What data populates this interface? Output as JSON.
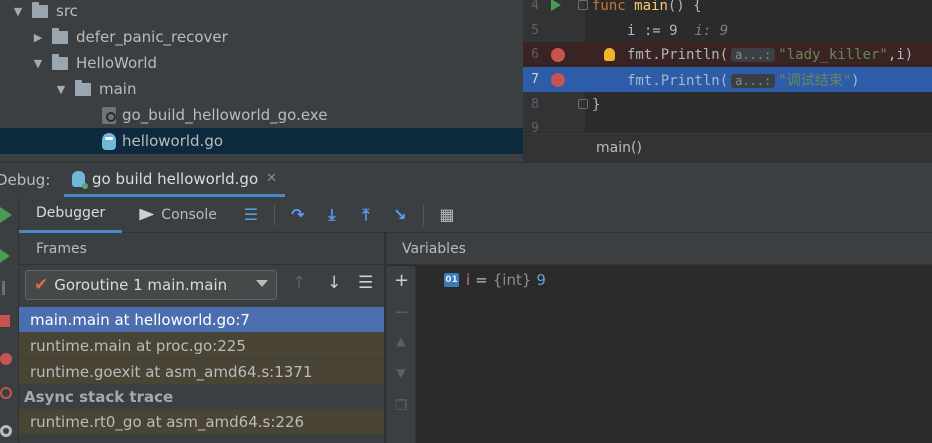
{
  "project_tree": {
    "items": [
      {
        "label": "src",
        "kind": "folder",
        "expanded": true
      },
      {
        "label": "defer_panic_recover",
        "kind": "folder",
        "expanded": false
      },
      {
        "label": "HelloWorld",
        "kind": "folder",
        "expanded": true
      },
      {
        "label": "main",
        "kind": "folder",
        "expanded": true
      },
      {
        "label": "go_build_helloworld_go.exe",
        "kind": "file-exe"
      },
      {
        "label": "helloworld.go",
        "kind": "file-go",
        "selected": true
      }
    ]
  },
  "editor": {
    "lines": [
      {
        "num": "4",
        "code_kw": "func",
        "code_fn": "main",
        "code_rest": "() {"
      },
      {
        "num": "5",
        "code": "i := 9",
        "inlay": "i: 9"
      },
      {
        "num": "6",
        "code_pre": "fmt.Println(",
        "hint": "a...:",
        "str": "\"lady_killer\"",
        "code_post": ",i)",
        "breakpoint": true
      },
      {
        "num": "7",
        "code_pre": "fmt.Println(",
        "hint": "a...:",
        "str": "\"调试结束\"",
        "code_post": ")",
        "breakpoint": true,
        "current": true
      },
      {
        "num": "8",
        "code": "}"
      },
      {
        "num": "9",
        "code": ""
      }
    ],
    "breadcrumb": "main()"
  },
  "debug_bar": {
    "label": "Debug:",
    "session_tab": "go build helloworld.go",
    "close": "✕"
  },
  "debugger_toolbar": {
    "tabs": [
      {
        "label": "Debugger",
        "active": true
      },
      {
        "label": "Console",
        "active": false
      }
    ],
    "icons": [
      "menu-icon",
      "step-over-icon",
      "step-into-icon",
      "step-out-icon",
      "run-to-cursor-icon",
      "evaluate-icon"
    ]
  },
  "frames": {
    "header": "Frames",
    "goroutine": "Goroutine 1 main.main",
    "items": [
      {
        "label": "main.main at helloworld.go:7",
        "selected": true
      },
      {
        "label": "runtime.main at proc.go:225",
        "library": true
      },
      {
        "label": "runtime.goexit at asm_amd64.s:1371",
        "library": true
      }
    ],
    "async_header": "Async stack trace",
    "async_items": [
      {
        "label": "runtime.rt0_go at asm_amd64.s:226",
        "library": true
      }
    ]
  },
  "variables": {
    "header": "Variables",
    "items": [
      {
        "icon": "01",
        "name": "i",
        "eq": "=",
        "type": "{int}",
        "value": "9"
      }
    ]
  },
  "colors": {
    "selection": "#4b6eaf",
    "current_line": "#2d5da8",
    "breakpoint": "#c75450",
    "string": "#6a8759",
    "keyword": "#cc7832"
  }
}
